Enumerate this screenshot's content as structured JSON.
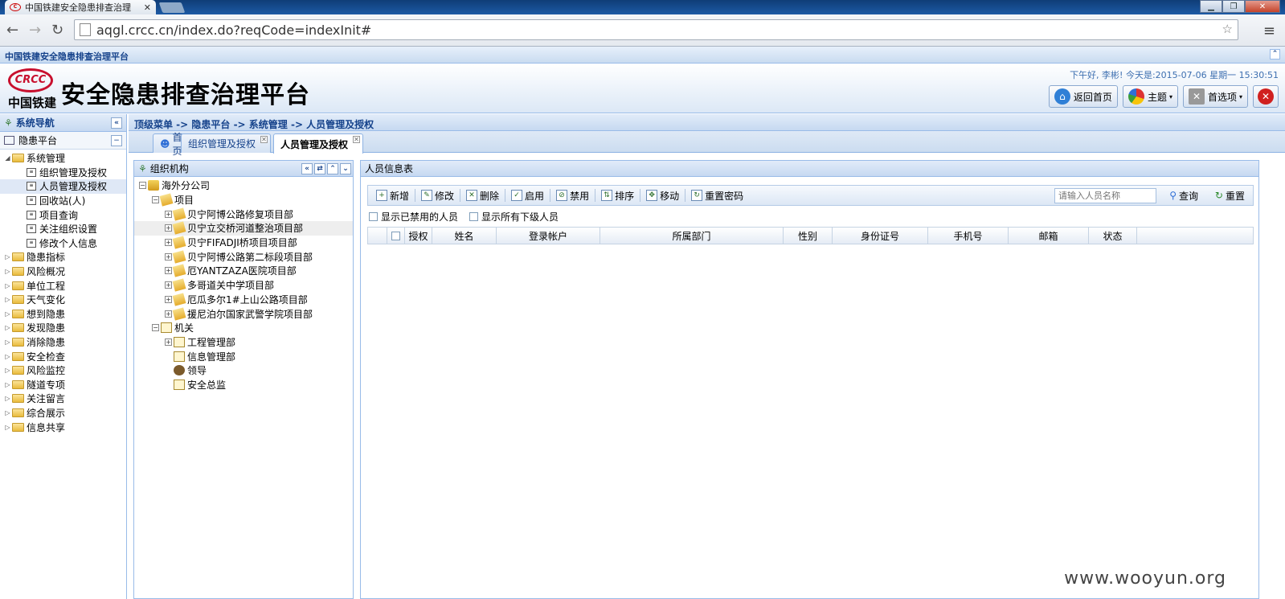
{
  "browser": {
    "tab_title": "中国铁建安全隐患排查治理",
    "url": "aqgl.crcc.cn/index.do?reqCode=indexInit#"
  },
  "app": {
    "top_title": "中国铁建安全隐患排查治理平台",
    "logo_text": "CRCC",
    "logo_cn": "中国铁建",
    "big_title": "安全隐患排查治理平台",
    "greeting": "下午好, 李彬! 今天是:2015-07-06 星期一 15:30:51",
    "buttons": {
      "home": "返回首页",
      "theme": "主题",
      "prefs": "首选项"
    }
  },
  "leftnav": {
    "title": "系统导航",
    "section": "隐患平台",
    "items": [
      {
        "label": "系统管理",
        "type": "folder",
        "open": true
      },
      {
        "label": "组织管理及授权",
        "type": "leaf"
      },
      {
        "label": "人员管理及授权",
        "type": "leaf",
        "selected": true
      },
      {
        "label": "回收站(人)",
        "type": "leaf"
      },
      {
        "label": "项目查询",
        "type": "leaf"
      },
      {
        "label": "关注组织设置",
        "type": "leaf"
      },
      {
        "label": "修改个人信息",
        "type": "leaf"
      },
      {
        "label": "隐患指标",
        "type": "folder"
      },
      {
        "label": "风险概况",
        "type": "folder"
      },
      {
        "label": "单位工程",
        "type": "folder"
      },
      {
        "label": "天气变化",
        "type": "folder"
      },
      {
        "label": "想到隐患",
        "type": "folder"
      },
      {
        "label": "发现隐患",
        "type": "folder"
      },
      {
        "label": "消除隐患",
        "type": "folder"
      },
      {
        "label": "安全检查",
        "type": "folder"
      },
      {
        "label": "风险监控",
        "type": "folder"
      },
      {
        "label": "隧道专项",
        "type": "folder"
      },
      {
        "label": "关注留言",
        "type": "folder"
      },
      {
        "label": "综合展示",
        "type": "folder"
      },
      {
        "label": "信息共享",
        "type": "folder"
      }
    ]
  },
  "breadcrumb": "顶级菜单 -> 隐患平台 -> 系统管理 -> 人员管理及授权",
  "tabs": [
    "首页",
    "组织管理及授权",
    "人员管理及授权"
  ],
  "org": {
    "title": "组织机构",
    "nodes": [
      {
        "label": "海外分公司",
        "level": 0,
        "toggle": "−",
        "icon": "co"
      },
      {
        "label": "项目",
        "level": 1,
        "toggle": "−",
        "icon": "pj"
      },
      {
        "label": "贝宁阿博公路修复项目部",
        "level": 2,
        "toggle": "+",
        "icon": "pj"
      },
      {
        "label": "贝宁立交桥河道整治项目部",
        "level": 2,
        "toggle": "+",
        "icon": "pj",
        "hover": true
      },
      {
        "label": "贝宁FIFADJI桥项目项目部",
        "level": 2,
        "toggle": "+",
        "icon": "pj"
      },
      {
        "label": "贝宁阿博公路第二标段项目部",
        "level": 2,
        "toggle": "+",
        "icon": "pj"
      },
      {
        "label": "厄YANTZAZA医院项目部",
        "level": 2,
        "toggle": "+",
        "icon": "pj"
      },
      {
        "label": "多哥道关中学项目部",
        "level": 2,
        "toggle": "+",
        "icon": "pj"
      },
      {
        "label": "厄瓜多尔1#上山公路项目部",
        "level": 2,
        "toggle": "+",
        "icon": "pj"
      },
      {
        "label": "援尼泊尔国家武警学院项目部",
        "level": 2,
        "toggle": "+",
        "icon": "pj"
      },
      {
        "label": "机关",
        "level": 1,
        "toggle": "−",
        "icon": "dp"
      },
      {
        "label": "工程管理部",
        "level": 2,
        "toggle": "+",
        "icon": "dp"
      },
      {
        "label": "信息管理部",
        "level": 2,
        "toggle": "",
        "icon": "dp"
      },
      {
        "label": "领导",
        "level": 2,
        "toggle": "",
        "icon": "pp"
      },
      {
        "label": "安全总监",
        "level": 2,
        "toggle": "",
        "icon": "dp"
      }
    ]
  },
  "staff": {
    "title": "人员信息表",
    "toolbar": [
      "新增",
      "修改",
      "删除",
      "启用",
      "禁用",
      "排序",
      "移动",
      "重置密码"
    ],
    "search_placeholder": "请输入人员名称",
    "query": "查询",
    "reset": "重置",
    "filters": [
      "显示已禁用的人员",
      "显示所有下级人员"
    ],
    "columns": [
      "授权",
      "姓名",
      "登录帐户",
      "所属部门",
      "性别",
      "身份证号",
      "手机号",
      "邮箱",
      "状态"
    ]
  },
  "watermark": "www.wooyun.org"
}
